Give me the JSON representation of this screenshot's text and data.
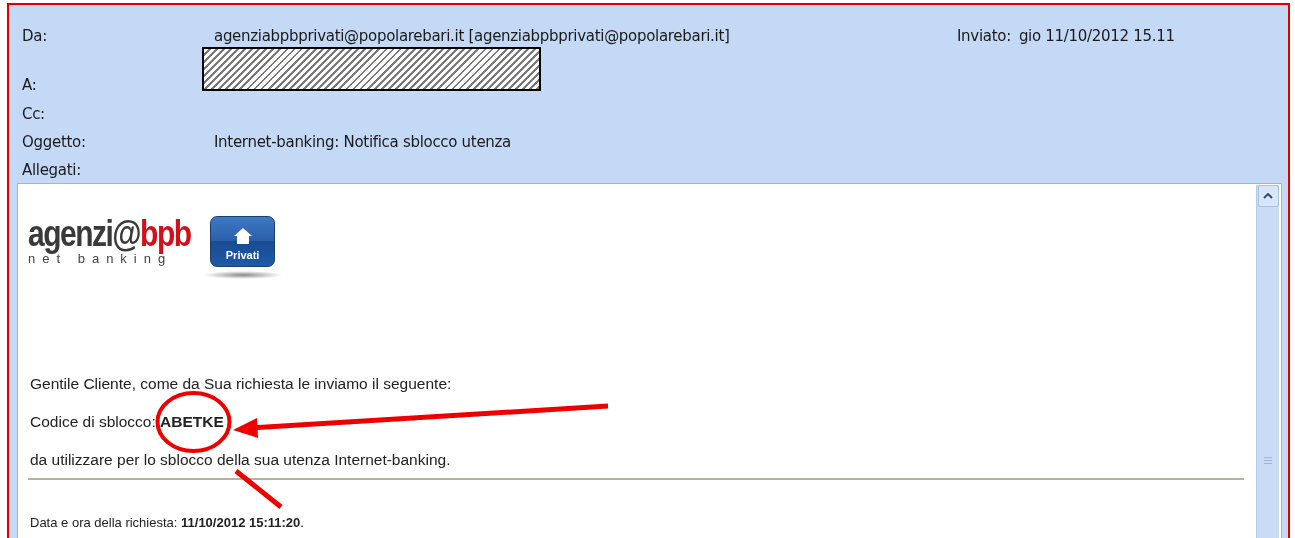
{
  "header": {
    "fields": [
      {
        "label": "Da:",
        "value": "agenziabpbprivati@popolarebari.it [agenziabpbprivati@popolarebari.it]",
        "redacted": false
      },
      {
        "label": "A:",
        "redacted": true
      },
      {
        "label": "Cc:",
        "redacted": false
      },
      {
        "label": "Oggetto:",
        "value": "Internet-banking: Notifica sblocco utenza",
        "redacted": false
      },
      {
        "label": "Allegati:",
        "redacted": false
      }
    ],
    "sent": {
      "label": "Inviato:",
      "value": "gio 11/10/2012 15.11"
    }
  },
  "logo": {
    "brand": "agenzi@",
    "brand_accent": "bpb",
    "tagline": "net banking",
    "badge": "Privati"
  },
  "body": {
    "paragraphs": [
      "Gentile Cliente, come da Sua richiesta le inviamo il seguente:",
      "Codice di sblocco: **ABETKE**",
      "da utilizzare per lo sblocco della sua utenza Internet-banking."
    ],
    "footer": "Data e ora della richiesta: **11/10/2012 15:11:20**."
  }
}
